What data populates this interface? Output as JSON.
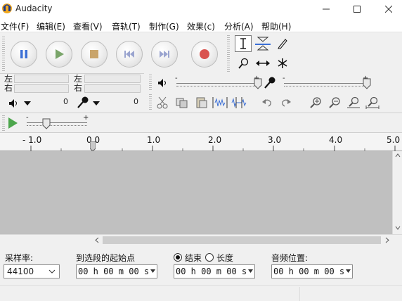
{
  "window": {
    "title": "Audacity"
  },
  "menu": [
    {
      "label": "文件(F)"
    },
    {
      "label": "编辑(E)"
    },
    {
      "label": "查看(V)"
    },
    {
      "label": "音轨(T)"
    },
    {
      "label": "制作(G)"
    },
    {
      "label": "效果(c)"
    },
    {
      "label": "分析(A)"
    },
    {
      "label": "帮助(H)"
    }
  ],
  "meters": {
    "left_label": "左",
    "right_label": "右",
    "left_label2": "左",
    "right_label2": "右",
    "play_zero": "0",
    "rec_zero": "0"
  },
  "sliders": {
    "minus": "-",
    "plus": "+"
  },
  "ruler": {
    "ticks": [
      "- 1.0",
      "0.0",
      "1.0",
      "2.0",
      "3.0",
      "4.0",
      "5.0"
    ]
  },
  "selection": {
    "rate_label": "采样率:",
    "rate_value": "44100",
    "start_label": "到选段的起始点",
    "end_label": "结束",
    "length_label": "长度",
    "pos_label": "音频位置:",
    "time1": "00 h 00 m 00 s",
    "time2": "00 h 00 m 00 s",
    "time3": "00 h 00 m 00 s"
  },
  "colors": {
    "pause": "#3b6fd6",
    "play": "#6aa84f",
    "stop": "#c9a46a",
    "record": "#d9534f",
    "track_bg": "#c0c0c0"
  }
}
